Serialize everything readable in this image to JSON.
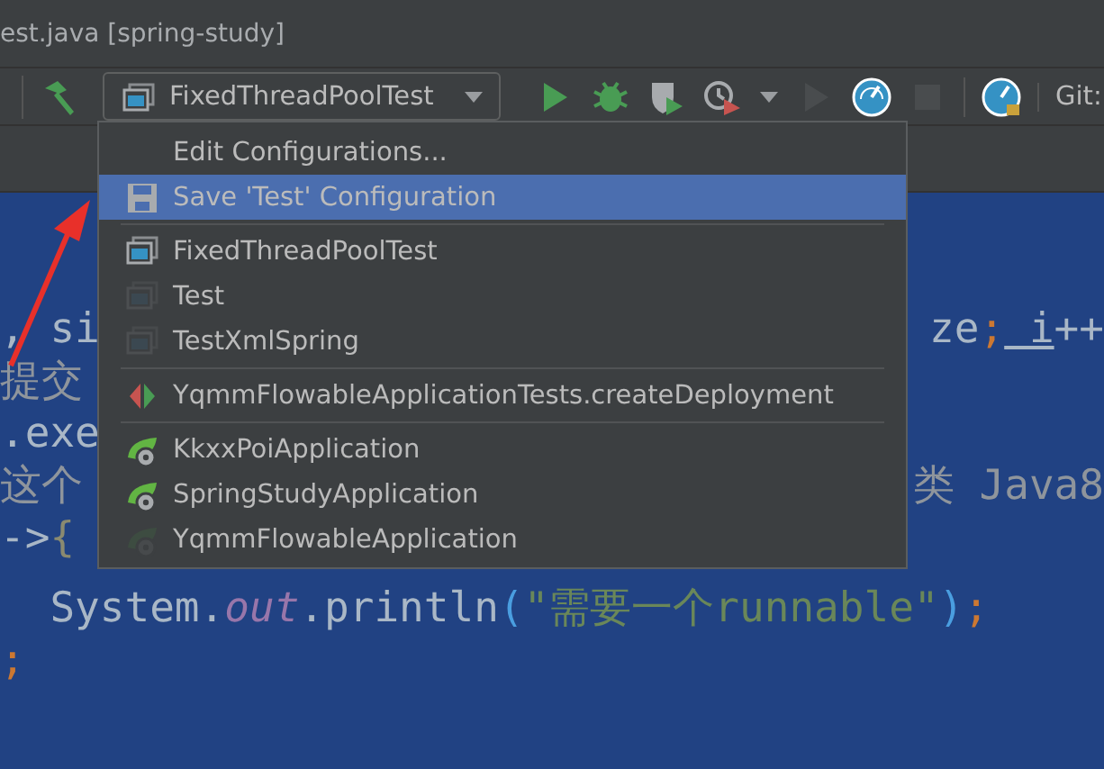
{
  "window": {
    "title": "est.java [spring-study]"
  },
  "toolbar": {
    "run_configuration": "FixedThreadPoolTest",
    "buttons": [
      {
        "kind": "run",
        "disabled": false
      },
      {
        "kind": "debug",
        "disabled": false
      },
      {
        "kind": "coverage",
        "disabled": false
      },
      {
        "kind": "profile",
        "disabled": false
      },
      {
        "kind": "run",
        "disabled": true
      },
      {
        "kind": "gauge",
        "disabled": false
      },
      {
        "kind": "stop",
        "disabled": true
      },
      {
        "kind": "gauge2",
        "disabled": false
      }
    ],
    "git_label": "Git:"
  },
  "editor": {
    "lines": [
      {
        "left": [
          {
            "text": ", si",
            "kind": "plain"
          }
        ],
        "right": [
          {
            "text": "ze",
            "kind": "plain"
          },
          {
            "text": ";",
            "kind": "semi"
          },
          {
            "text": " i",
            "kind": "var"
          },
          {
            "text": "++",
            "kind": "plain"
          }
        ]
      },
      {
        "left": [
          {
            "text": "提交",
            "kind": "comment"
          }
        ]
      },
      {
        "left": [
          {
            "text": ".exe",
            "kind": "plain"
          }
        ]
      },
      {
        "left": [
          {
            "text": "这个",
            "kind": "comment"
          }
        ],
        "right": [
          {
            "text": "类 Java8",
            "kind": "comment"
          }
        ]
      },
      {
        "left": [
          {
            "text": "->",
            "kind": "plain"
          },
          {
            "text": "{",
            "kind": "brace"
          }
        ]
      },
      {
        "left": [
          {
            "text": "  System.",
            "kind": "plain"
          },
          {
            "text": "out",
            "kind": "field"
          },
          {
            "text": ".println",
            "kind": "plain"
          },
          {
            "text": "(",
            "kind": "paren"
          },
          {
            "text": "\"需要一个runnable\"",
            "kind": "string"
          },
          {
            "text": ")",
            "kind": "paren"
          },
          {
            "text": ";",
            "kind": "semi"
          }
        ]
      },
      {
        "left": [
          {
            "text": ";",
            "kind": "semi"
          }
        ]
      }
    ]
  },
  "menu": {
    "groups": [
      [
        {
          "label": "Edit Configurations...",
          "kind": "action",
          "selected": false,
          "dimmed": false
        },
        {
          "label": "Save 'Test' Configuration",
          "kind": "save",
          "selected": true,
          "dimmed": false
        }
      ],
      [
        {
          "label": "FixedThreadPoolTest",
          "kind": "app",
          "selected": false,
          "dimmed": false
        },
        {
          "label": "Test",
          "kind": "app",
          "selected": false,
          "dimmed": true
        },
        {
          "label": "TestXmlSpring",
          "kind": "app",
          "selected": false,
          "dimmed": true
        }
      ],
      [
        {
          "label": "YqmmFlowableApplicationTests.createDeployment",
          "kind": "test",
          "selected": false,
          "dimmed": false
        }
      ],
      [
        {
          "label": "KkxxPoiApplication",
          "kind": "spring",
          "selected": false,
          "dimmed": false
        },
        {
          "label": "SpringStudyApplication",
          "kind": "spring",
          "selected": false,
          "dimmed": false
        },
        {
          "label": "YqmmFlowableApplication",
          "kind": "spring",
          "selected": false,
          "dimmed": true
        }
      ]
    ]
  }
}
